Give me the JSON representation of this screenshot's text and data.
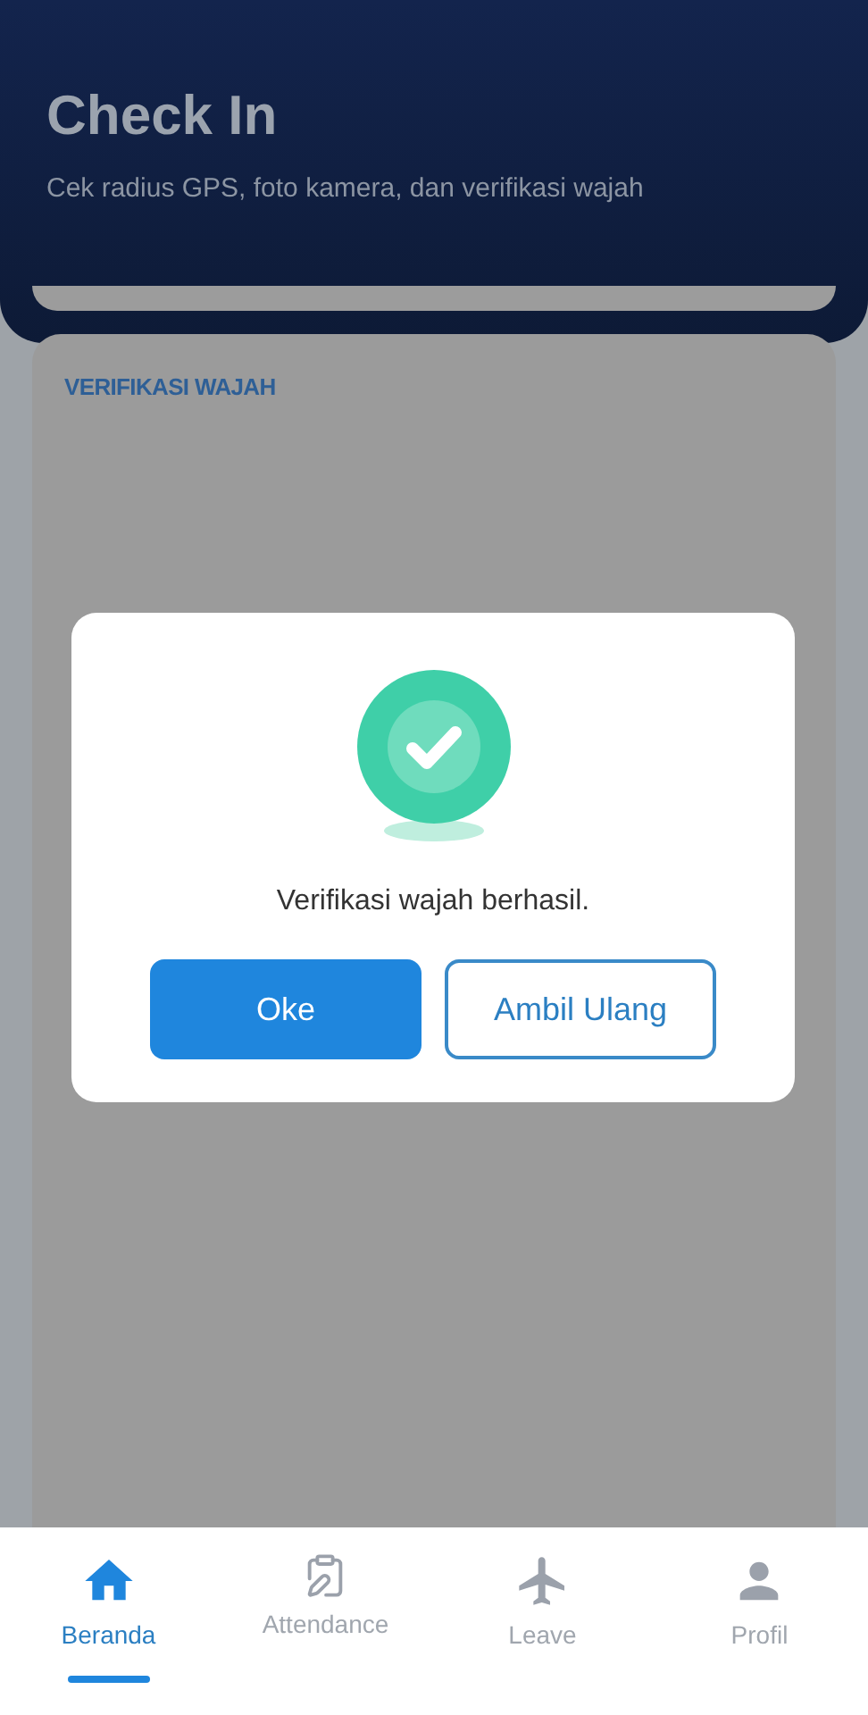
{
  "header": {
    "title": "Check In",
    "subtitle": "Cek radius GPS, foto kamera, dan verifikasi wajah"
  },
  "section": {
    "label": "VERIFIKASI WAJAH"
  },
  "dialog": {
    "message": "Verifikasi wajah berhasil.",
    "buttons": [
      {
        "label": "Oke",
        "kind": "primary"
      },
      {
        "label": "Ambil Ulang",
        "kind": "outline"
      }
    ]
  },
  "nav": [
    {
      "label": "Beranda",
      "selected": true
    },
    {
      "label": "Attendance",
      "selected": false
    },
    {
      "label": "Leave",
      "selected": false
    },
    {
      "label": "Profil",
      "selected": false
    }
  ]
}
